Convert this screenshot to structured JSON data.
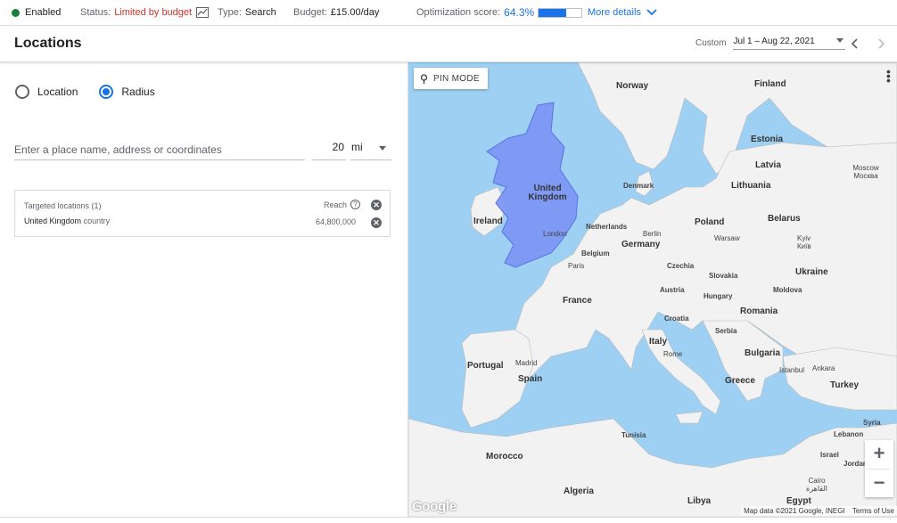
{
  "status_bar": {
    "enabled_label": "Enabled",
    "status_label": "Status:",
    "status_value": "Limited by budget",
    "type_label": "Type:",
    "type_value": "Search",
    "budget_label": "Budget:",
    "budget_value": "£15.00/day",
    "optimization_label": "Optimization score:",
    "optimization_value": "64.3%",
    "optimization_fraction": 0.643,
    "more_details": "More details"
  },
  "header": {
    "title": "Locations",
    "date_preset": "Custom",
    "date_range": "Jul 1 – Aug 22, 2021"
  },
  "targeting": {
    "options": [
      {
        "label": "Location",
        "selected": false
      },
      {
        "label": "Radius",
        "selected": true
      }
    ],
    "place_placeholder": "Enter a place name, address or coordinates",
    "radius_value": "20",
    "radius_unit": "mi",
    "targeted_header": "Targeted locations (1)",
    "reach_label": "Reach",
    "locations": [
      {
        "name": "United Kingdom",
        "type": "country",
        "reach": "64,800,000"
      }
    ]
  },
  "map": {
    "pin_mode_label": "PIN MODE",
    "country_labels": [
      "Norway",
      "Finland",
      "Estonia",
      "Latvia",
      "Lithuania",
      "Denmark",
      "United Kingdom",
      "Ireland",
      "Netherlands",
      "Belgium",
      "Germany",
      "Poland",
      "Belarus",
      "Czechia",
      "Slovakia",
      "Austria",
      "Hungary",
      "Moldova",
      "Ukraine",
      "Romania",
      "France",
      "Croatia",
      "Serbia",
      "Bulgaria",
      "Italy",
      "Portugal",
      "Spain",
      "Greece",
      "Turkey",
      "Tunisia",
      "Morocco",
      "Algeria",
      "Libya",
      "Egypt",
      "Syria",
      "Lebanon",
      "Israel",
      "Jordan"
    ],
    "city_labels": [
      "Moscow Москва",
      "London",
      "Berlin",
      "Warsaw",
      "Kyiv Київ",
      "Paris",
      "Madrid",
      "Rome",
      "Istanbul",
      "Ankara",
      "Cairo القاهرة"
    ],
    "google_logo": "Google",
    "attribution": "Map data ©2021 Google, INEGI",
    "terms": "Terms of Use",
    "colors": {
      "water": "#9dd0f2",
      "land": "#f2f2f2",
      "highlight": "#7b94f5"
    }
  }
}
